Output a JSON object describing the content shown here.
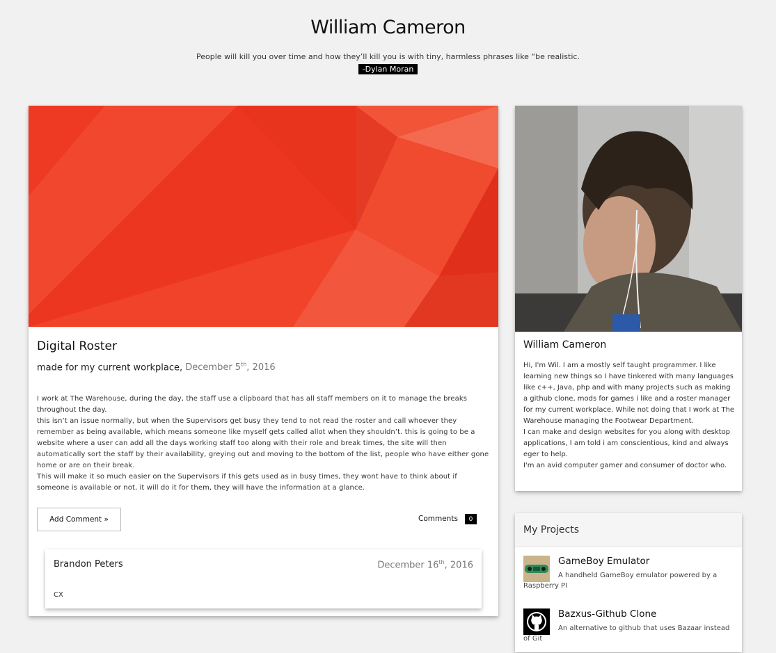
{
  "header": {
    "title": "William Cameron",
    "quote": "People will kill you over time and how they’ll kill you is with tiny, harmless phrases like “be realistic.",
    "quote_author": "-Dylan Moran"
  },
  "post": {
    "title": "Digital Roster",
    "subtitle": "made for my current workplace,",
    "date_prefix": "December 5",
    "date_suffix": "th",
    "date_year": ", 2016",
    "body": [
      "I work at The Warehouse, during the day, the staff use a clipboard that has all staff members on it to manage the breaks throughout the day.",
      "this isn’t an issue normally, but when the Supervisors get busy they tend to not read the roster and call whoever they remember as being available, which means someone like myself gets called allot when they shouldn’t. this is going to be a website where a user can add all the days working staff too along with their role and break times, the site will then automatically sort the staff by their availability, greying out and moving to the bottom of the list, people who have either gone home or are on their break.",
      "This will make it so much easier on the Supervisors if this gets used as in busy times, they wont have to think about if someone is available or not, it will do it for them, they will have the information at a glance."
    ],
    "add_comment_label": "Add Comment »",
    "comments_label": "Comments",
    "comments_count": "0",
    "comment": {
      "author": "Brandon Peters",
      "date_prefix": "December 16",
      "date_suffix": "th",
      "date_year": ", 2016",
      "text": "CX"
    }
  },
  "profile": {
    "name": "William Cameron",
    "bio": [
      "Hi, I'm Wil. I am a mostly self taught programmer. I like learning new things so I have tinkered with many languages like c++, Java, php and with many projects such as making a github clone, mods for games i like and a roster manager for my current workplace. While not doing that I work at The Warehouse managing the Footwear Department.",
      "I can make and design websites for you along with desktop applications, I am told i am conscientious, kind and always eger to help.",
      "I'm an avid computer gamer and consumer of doctor who."
    ]
  },
  "projects": {
    "heading": "My Projects",
    "items": [
      {
        "title": "GameBoy Emulator",
        "description": "A handheld GameBoy emulator powered by a Raspberry PI",
        "icon": "gameboy-board-icon"
      },
      {
        "title": "Bazxus-Github Clone",
        "description": "An alternative to github that uses Bazaar instead of Git",
        "icon": "github-octocat-icon"
      }
    ]
  },
  "colors": {
    "hero_red": "#f0412a",
    "background": "#f1f1f1",
    "badge_black": "#000000"
  }
}
